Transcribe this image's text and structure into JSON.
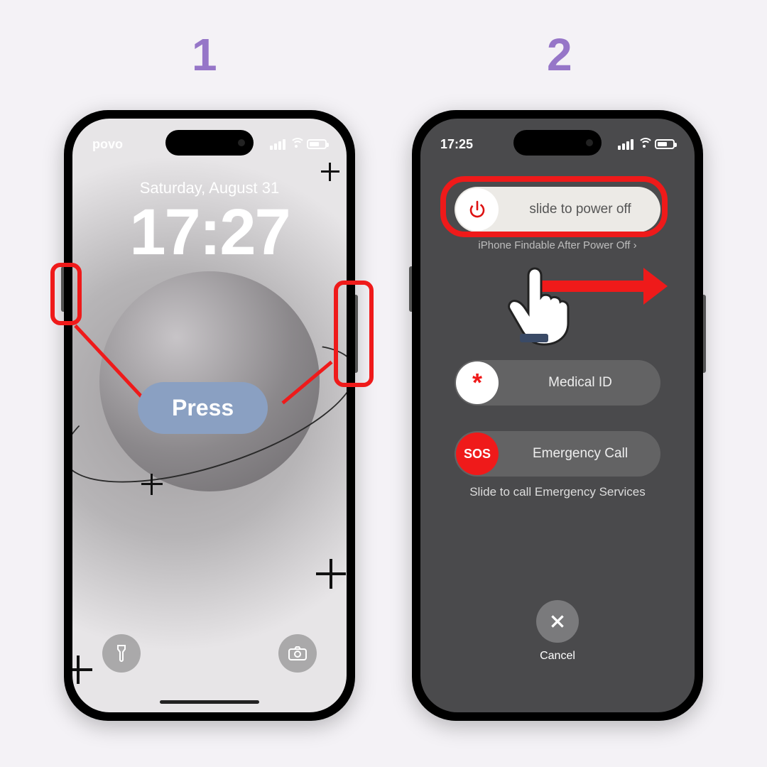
{
  "steps": {
    "one": "1",
    "two": "2"
  },
  "colors": {
    "highlight": "#ef1a1a",
    "step_number": "#9676c8",
    "press_pill": "#8aa0c2"
  },
  "phone1": {
    "carrier": "povo",
    "date": "Saturday, August 31",
    "time": "17:27",
    "press_label": "Press",
    "flashlight_icon": "flashlight-icon",
    "camera_icon": "camera-icon"
  },
  "phone2": {
    "status_time": "17:25",
    "power_slider": "slide to power off",
    "findable": "iPhone Findable After Power Off",
    "medical_label": "Medical ID",
    "medical_icon": "*",
    "sos_label": "Emergency Call",
    "sos_icon": "SOS",
    "sos_hint": "Slide to call Emergency Services",
    "cancel": "Cancel"
  }
}
